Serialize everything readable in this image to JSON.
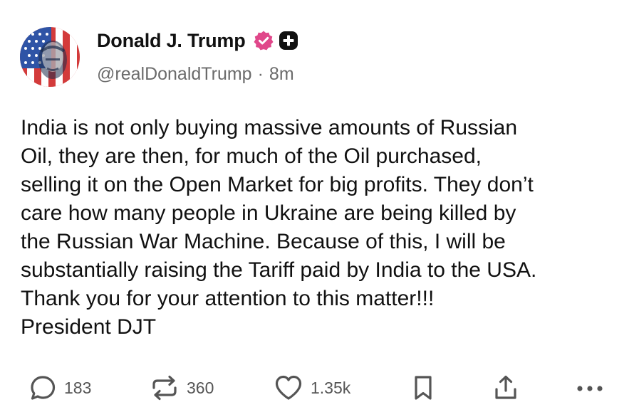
{
  "author": {
    "name": "Donald J. Trump",
    "handle": "@realDonaldTrump",
    "separator": "·",
    "time": "8m",
    "verified_icon": "verified-badge-icon",
    "accent_color": "#e0478a"
  },
  "post": {
    "lines": [
      "India is not only buying massive amounts of Russian",
      "Oil, they are then, for much of the Oil purchased,",
      "selling it on the Open Market for big profits. They don’t",
      "care how many people in Ukraine are being killed by",
      "the Russian War Machine. Because of this, I will be",
      "substantially raising the Tariff paid by India to the USA.",
      "Thank you for your attention to this matter!!!",
      "President DJT"
    ]
  },
  "actions": {
    "replies": "183",
    "retruths": "360",
    "likes": "1.35k",
    "icons": [
      "reply-icon",
      "retruth-icon",
      "like-icon",
      "bookmark-icon",
      "share-icon",
      "more-icon"
    ]
  }
}
